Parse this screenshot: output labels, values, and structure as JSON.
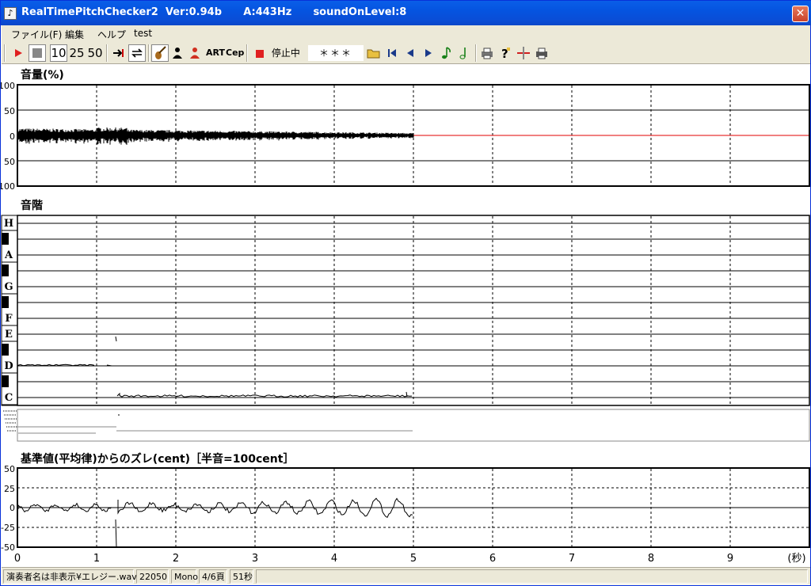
{
  "title": {
    "app": "RealTimePitchChecker2",
    "version": "Ver:0.94b",
    "a_freq": "A:443Hz",
    "sound_level": "soundOnLevel:8",
    "close_glyph": "✕"
  },
  "menu": {
    "items": [
      {
        "label": "ファイル(F)"
      },
      {
        "label": "編集"
      },
      {
        "label": "ヘルプ"
      },
      {
        "label": "test"
      }
    ]
  },
  "toolbar": {
    "play_icon": "play-icon",
    "stop_icon": "stop-icon",
    "zoom_options": [
      "10",
      "25",
      "50"
    ],
    "art_label": "ART",
    "cep_label": "Cep",
    "state_label": "停止中",
    "note_display": "＊＊＊"
  },
  "volume_panel": {
    "title": "音量(%)",
    "y_ticks": [
      "100",
      "50",
      "0",
      "50",
      "100"
    ]
  },
  "scale_panel": {
    "title": "音階",
    "notes": [
      "H",
      "A",
      "G",
      "F",
      "E",
      "D",
      "C"
    ]
  },
  "deviation_panel": {
    "title": "基準値(平均律)からのズレ(cent)［半音=100cent］",
    "y_ticks": [
      "50",
      "25",
      "0",
      "-25",
      "-50"
    ],
    "x_ticks": [
      "0",
      "1",
      "2",
      "3",
      "4",
      "5",
      "6",
      "7",
      "8",
      "9"
    ],
    "x_unit": "(秒)"
  },
  "status": {
    "file": "演奏者名は非表示¥エレジー.wav",
    "rate": "22050",
    "channels": "Mono",
    "page": "4/6頁",
    "duration": "51秒"
  },
  "colors": {
    "titlebar": "#0a5ee8",
    "zero_line_idle": "#e00000",
    "signal": "#000000"
  }
}
